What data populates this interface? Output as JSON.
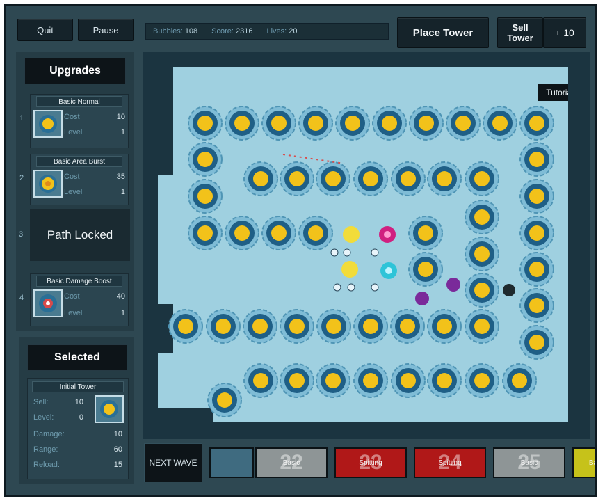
{
  "toolbar": {
    "quit_label": "Quit",
    "pause_label": "Pause",
    "place_tower_label": "Place Tower",
    "sell_tower_label": "Sell Tower",
    "sell_value": "+ 10"
  },
  "stats": {
    "bubbles_label": "Bubbles:",
    "bubbles_value": "108",
    "score_label": "Score:",
    "score_value": "2316",
    "lives_label": "Lives:",
    "lives_value": "20"
  },
  "upgrades": {
    "title": "Upgrades",
    "items": [
      {
        "num": "1",
        "name": "Basic Normal",
        "cost_label": "Cost",
        "cost": "10",
        "level_label": "Level",
        "level": "1",
        "icon": "normal-tower-icon"
      },
      {
        "num": "2",
        "name": "Basic Area Burst",
        "cost_label": "Cost",
        "cost": "35",
        "level_label": "Level",
        "level": "1",
        "icon": "area-burst-tower-icon"
      },
      {
        "num": "3",
        "name": "Path Locked"
      },
      {
        "num": "4",
        "name": "Basic Damage Boost",
        "cost_label": "Cost",
        "cost": "40",
        "level_label": "Level",
        "level": "1",
        "icon": "damage-boost-tower-icon"
      }
    ]
  },
  "selected": {
    "title": "Selected",
    "tower_name": "Initial Tower",
    "sell_label": "Sell:",
    "sell": "10",
    "level_label": "Level:",
    "level": "0",
    "damage_label": "Damage:",
    "damage": "10",
    "range_label": "Range:",
    "range": "60",
    "reload_label": "Reload:",
    "reload": "15",
    "icon": "initial-tower-icon"
  },
  "map": {
    "tutorial_label": "Tutorial"
  },
  "wave_bar": {
    "next_wave_label": "NEXT WAVE",
    "waves": [
      {
        "num": "",
        "name": "",
        "color": "#3f6b80"
      },
      {
        "num": "22",
        "name": "Basic",
        "color": "#8e9596"
      },
      {
        "num": "23",
        "name": "Spitting",
        "color": "#b01818"
      },
      {
        "num": "24",
        "name": "Spitting",
        "color": "#b01818"
      },
      {
        "num": "25",
        "name": "Basic",
        "color": "#8e9596"
      },
      {
        "num": "",
        "name": "Ba",
        "color": "#c6c21a"
      }
    ]
  },
  "colors": {
    "frame": "#2e4852",
    "map_water": "#9fd0e0",
    "tower_core": "#f2c21a",
    "tower_ring": "#1f5f86",
    "enemy_magenta": "#d02080",
    "enemy_purple": "#7a2a9a"
  }
}
